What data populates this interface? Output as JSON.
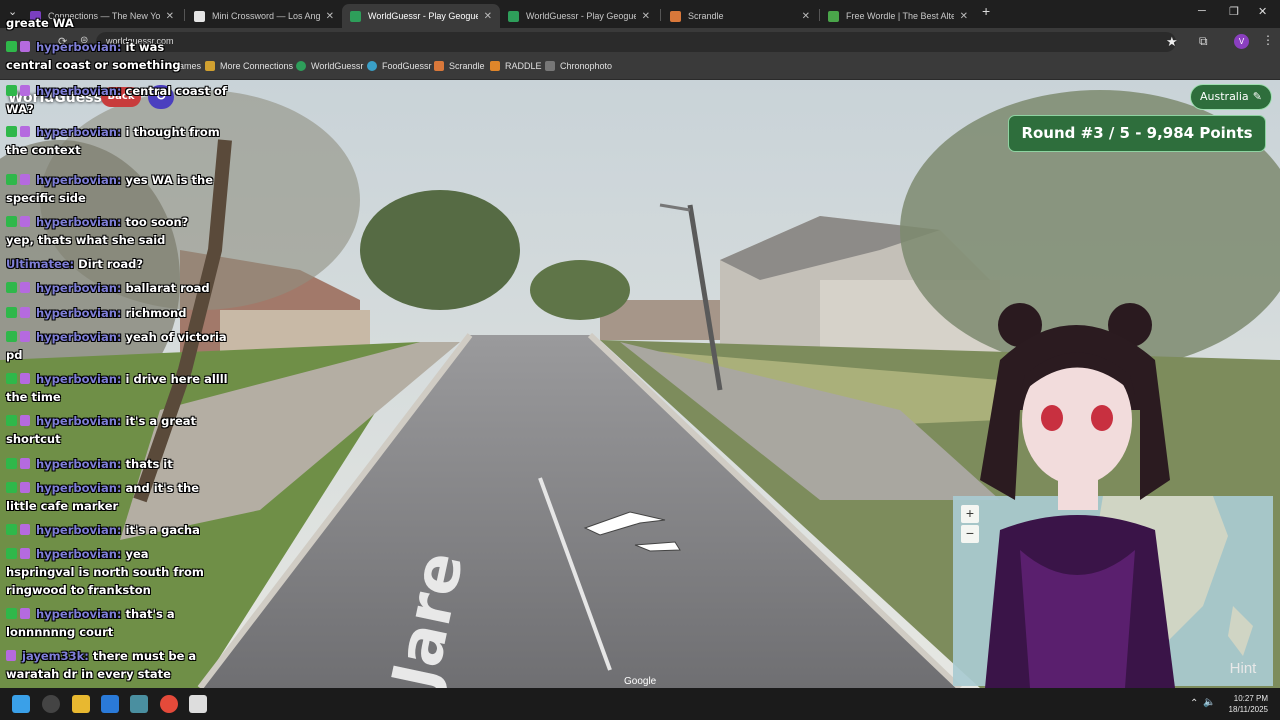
{
  "browser": {
    "tabs": [
      {
        "title": "Connections — The New York Times",
        "favicon_color": "#7a3fbf"
      },
      {
        "title": "Mini Crossword — Los Angeles Times",
        "favicon_color": "#e5e5e5"
      },
      {
        "title": "WorldGuessr - Play Geoguessr Free",
        "favicon_color": "#2e9e5a",
        "active": true
      },
      {
        "title": "WorldGuessr - Play Geoguessr Free",
        "favicon_color": "#2e9e5a"
      },
      {
        "title": "Scrandle",
        "favicon_color": "#d9783a"
      },
      {
        "title": "Free Wordle | The Best Alternative",
        "favicon_color": "#4aa54a"
      }
    ],
    "new_tab": "+",
    "url": "worldguessr.com",
    "bookmarks": [
      "Games",
      "More Connections",
      "WorldGuessr",
      "FoodGuessr",
      "Scrandle",
      "RADDLE",
      "Chronophoto"
    ]
  },
  "game": {
    "logo": "WorldGuessr",
    "back": "Back",
    "country": "Australia",
    "round_text": "Round #3 / 5 - 9,984 Points",
    "google": "Google",
    "road_label": "Jare",
    "hint": "Hint",
    "zoom_in": "+",
    "zoom_out": "−"
  },
  "chat": [
    {
      "text": "greate WA"
    },
    {
      "user": "hyperbovian:",
      "text": "it was"
    },
    {
      "text": "central coast or something"
    },
    {
      "user": "hyperbovian:",
      "text": "central coast of WA?"
    },
    {
      "user": "hyperbovian:",
      "text": "i thought from the context"
    },
    {
      "user": "hyperbovian:",
      "text": "yes WA is the specific side"
    },
    {
      "user": "hyperbovian:",
      "text": "too soon?"
    },
    {
      "text": "yep, thats what she said"
    },
    {
      "user": "Ultimatee:",
      "text": "Dirt road?"
    },
    {
      "user": "hyperbovian:",
      "text": "ballarat road"
    },
    {
      "user": "hyperbovian:",
      "text": "richmond"
    },
    {
      "user": "hyperbovian:",
      "text": "yeah of victoria pd"
    },
    {
      "user": "hyperbovian:",
      "text": "i drive here allll the time"
    },
    {
      "user": "hyperbovian:",
      "text": "it's a great shortcut"
    },
    {
      "user": "hyperbovian:",
      "text": "thats it"
    },
    {
      "user": "hyperbovian:",
      "text": "and it's the little cafe marker"
    },
    {
      "user": "hyperbovian:",
      "text": "it's a gacha"
    },
    {
      "user": "hyperbovian:",
      "text": "yea"
    },
    {
      "text": "hspringval is north south from ringwood to frankston"
    },
    {
      "user": "hyperbovian:",
      "text": "that's a lonnnnnng court"
    },
    {
      "user": "jayem33k:",
      "text": "there must be a waratah dr in every state"
    }
  ],
  "taskbar": {
    "time": "10:27 PM",
    "date": "18/11/2025"
  },
  "colors": {
    "accent_green": "#2e6e3c",
    "back_red": "#c83c3c",
    "chat_user": "#7f7fd8"
  }
}
